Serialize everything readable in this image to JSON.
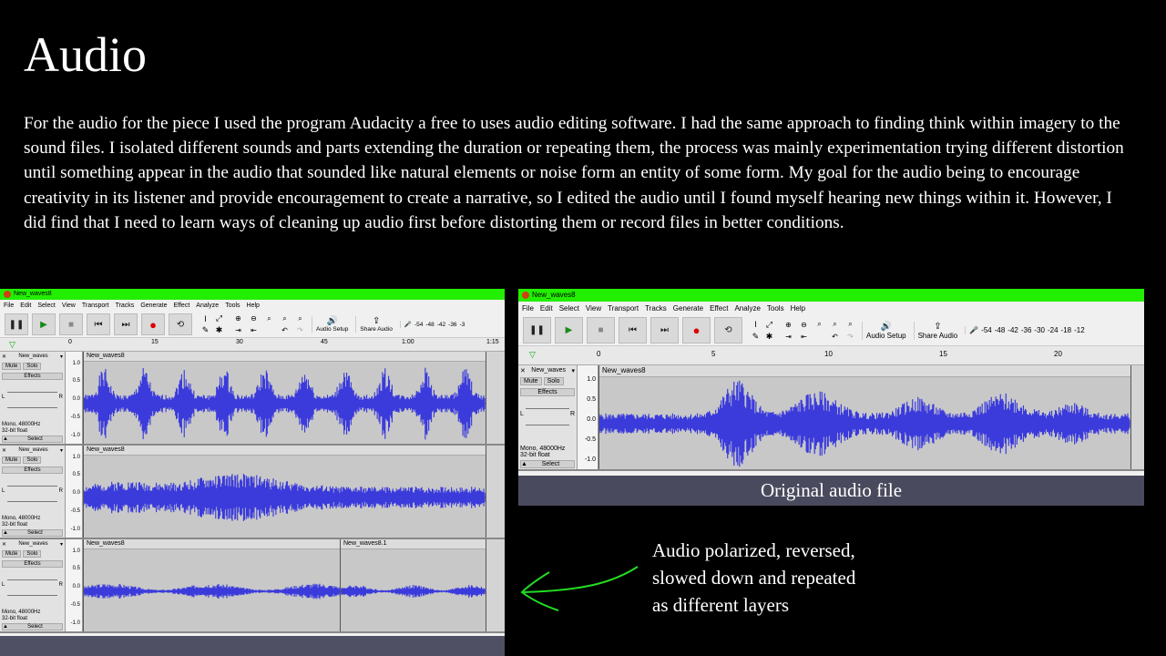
{
  "slide": {
    "title": "Audio",
    "body": "For the audio for the piece I used the program Audacity a free to uses audio editing software. I had the same approach to finding think within imagery to the sound files. I isolated different sounds and parts extending the duration or repeating them, the process was mainly experimentation trying different distortion until something appear in the audio that sounded like natural elements or noise form an entity of some form. My goal for the audio being to encourage creativity in its listener and provide encouragement to create a narrative, so I edited the audio until I found myself hearing new things within it. However, I did find that I need to learn ways of cleaning up audio first before distorting them or record files in better conditions.",
    "caption": "Original audio file",
    "annotation": "Audio polarized, reversed, slowed down and repeated as different layers",
    "arrow_color": "#22dd22"
  },
  "audacity": {
    "window_title": "New_waves8",
    "titlebar_color": "#22ee00",
    "waveform_color": "#3b3bdc",
    "menu": [
      "File",
      "Edit",
      "Select",
      "View",
      "Transport",
      "Tracks",
      "Generate",
      "Effect",
      "Analyze",
      "Tools",
      "Help"
    ],
    "audio_setup_label": "Audio Setup",
    "share_audio_label": "Share Audio",
    "meter_labels": [
      "-54",
      "-48",
      "-42",
      "-36",
      "-30",
      "-24",
      "-18",
      "-12"
    ],
    "meter_labels_short": [
      "-54",
      "-48",
      "-42",
      "-36",
      "-3"
    ],
    "mute_label": "Mute",
    "solo_label": "Solo",
    "effects_label": "Effects",
    "track_info_rate": "Mono, 48000Hz",
    "track_info_format": "32-bit float",
    "select_label": "Select",
    "track_name": "New_waves",
    "track_name_full": "New_waves8",
    "clip_name_2": "New_waves8.1",
    "pan_l": "L",
    "pan_r": "R",
    "scale": [
      "1.0",
      "0.5",
      "0.0",
      "-0.5",
      "-1.0"
    ],
    "left_ruler": [
      "0",
      "15",
      "30",
      "45",
      "1:00",
      "1:15"
    ],
    "right_ruler": [
      "0",
      "5",
      "10",
      "15",
      "20"
    ]
  }
}
